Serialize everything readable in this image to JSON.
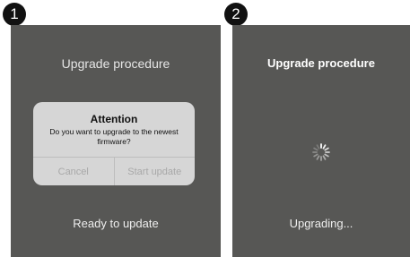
{
  "steps": [
    {
      "number": "1",
      "title": "Upgrade procedure",
      "dialog": {
        "title": "Attention",
        "message": "Do you want to upgrade to the newest firmware?",
        "cancel": "Cancel",
        "confirm": "Start update"
      },
      "status": "Ready to update"
    },
    {
      "number": "2",
      "title": "Upgrade procedure",
      "spinner_icon": "loading-spinner-icon",
      "status": "Upgrading..."
    }
  ]
}
